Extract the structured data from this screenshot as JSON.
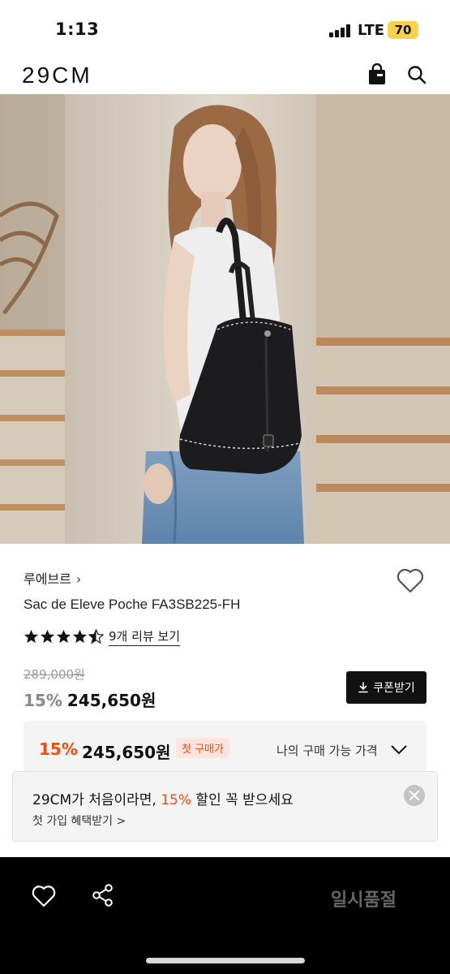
{
  "status_bar": {
    "time": "1:13",
    "network": "LTE",
    "battery": "70"
  },
  "header": {
    "logo": "29CM",
    "icons": [
      "shopping-bag-icon",
      "search-icon"
    ]
  },
  "product": {
    "brand": "루에브르",
    "brand_chevron": "›",
    "name": "Sac de Eleve Poche FA3SB225-FH",
    "rating": 4.5,
    "review_link": "9개 리뷰 보기",
    "original_price": "289,000원",
    "discount": "15%",
    "price": "245,650원",
    "coupon_button": "쿠폰받기"
  },
  "first_purchase": {
    "discount": "15%",
    "price": "245,650원",
    "badge": "첫 구매가",
    "label": "나의 구매 가능 가격"
  },
  "toast": {
    "title_prefix": "29CM가 처음이라면, ",
    "title_highlight": "15%",
    "title_suffix": " 할인 꼭 받으세요",
    "subtitle": "첫 가입 혜택받기 >"
  },
  "bottom_bar": {
    "soldout_label": "일시품절"
  },
  "colors": {
    "accent": "#ff4800",
    "dark": "#111111",
    "battery": "#f7d24a"
  }
}
